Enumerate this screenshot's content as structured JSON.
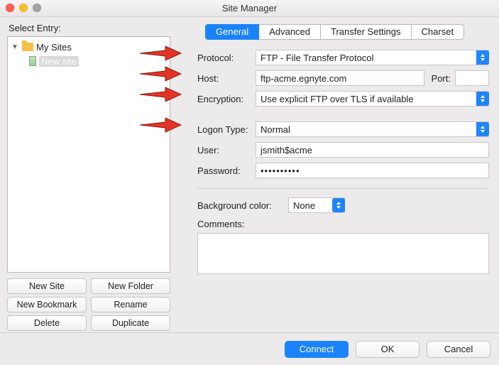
{
  "window": {
    "title": "Site Manager"
  },
  "left": {
    "label": "Select Entry:",
    "tree": {
      "root": "My Sites",
      "child": "New site"
    },
    "buttons": {
      "new_site": "New Site",
      "new_folder": "New Folder",
      "new_bookmark": "New Bookmark",
      "rename": "Rename",
      "delete": "Delete",
      "duplicate": "Duplicate"
    }
  },
  "tabs": {
    "general": "General",
    "advanced": "Advanced",
    "transfer": "Transfer Settings",
    "charset": "Charset"
  },
  "form": {
    "protocol_label": "Protocol:",
    "protocol_value": "FTP - File Transfer Protocol",
    "host_label": "Host:",
    "host_value": "ftp-acme.egnyte.com",
    "port_label": "Port:",
    "port_value": "",
    "encryption_label": "Encryption:",
    "encryption_value": "Use explicit FTP over TLS if available",
    "logon_label": "Logon Type:",
    "logon_value": "Normal",
    "user_label": "User:",
    "user_value": "jsmith$acme",
    "password_label": "Password:",
    "password_value": "••••••••••",
    "bgcolor_label": "Background color:",
    "bgcolor_value": "None",
    "comments_label": "Comments:"
  },
  "footer": {
    "connect": "Connect",
    "ok": "OK",
    "cancel": "Cancel"
  }
}
